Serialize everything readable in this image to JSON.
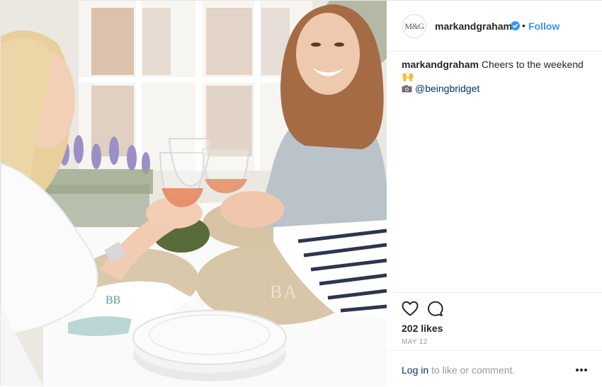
{
  "post": {
    "username": "markandgraham",
    "avatar_text": "M&G",
    "follow_label": "Follow",
    "dot_separator": "•",
    "caption": {
      "username": "markandgraham",
      "text": " Cheers to the weekend ",
      "emoji": "🙌",
      "mention": "@beingbridget"
    },
    "likes": "202 likes",
    "date": "MAY 12",
    "login_link": "Log in",
    "login_suffix": " to like or comment."
  },
  "photo": {
    "placemat_monograms": [
      "BB",
      "BA"
    ]
  },
  "icons": {
    "verified": "verified-badge-icon",
    "heart": "heart-outline-icon",
    "comment": "comment-bubble-icon",
    "more": "more-options-icon",
    "camera": "camera-icon"
  },
  "colors": {
    "link_blue": "#3897f0",
    "mention_navy": "#003569",
    "text": "#262626",
    "muted": "#999999",
    "border": "#efefef"
  }
}
